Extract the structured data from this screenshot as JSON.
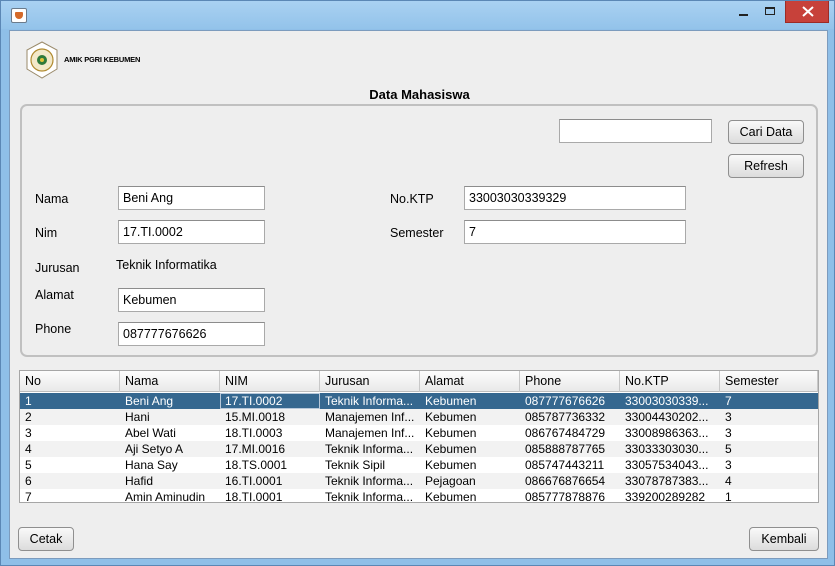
{
  "window": {
    "controls": {
      "minimize": "minimize-icon",
      "maximize": "maximize-icon",
      "close": "close-icon"
    }
  },
  "header": {
    "logo_text": "AMIK PGRI KEBUMEN",
    "title": "Data Mahasiswa"
  },
  "search": {
    "value": "",
    "button_label": "Cari Data",
    "refresh_label": "Refresh"
  },
  "form": {
    "nama_label": "Nama",
    "nama_value": "Beni Ang",
    "nim_label": "Nim",
    "nim_value": "17.TI.0002",
    "jurusan_label": "Jurusan",
    "jurusan_value": "Teknik Informatika",
    "alamat_label": "Alamat",
    "alamat_value": "Kebumen",
    "phone_label": "Phone",
    "phone_value": "087777676626",
    "ktp_label": "No.KTP",
    "ktp_value": "33003030339329",
    "semester_label": "Semester",
    "semester_value": "7"
  },
  "table": {
    "columns": [
      "No",
      "Nama",
      "NIM",
      "Jurusan",
      "Alamat",
      "Phone",
      "No.KTP",
      "Semester"
    ],
    "rows": [
      [
        "1",
        "Beni Ang",
        "17.TI.0002",
        "Teknik Informa...",
        "Kebumen",
        "087777676626",
        "33003030339...",
        "7"
      ],
      [
        "2",
        "Hani",
        "15.MI.0018",
        "Manajemen Inf...",
        "Kebumen",
        "085787736332",
        "33004430202...",
        "3"
      ],
      [
        "3",
        "Abel Wati",
        "18.TI.0003",
        "Manajemen Inf...",
        "Kebumen",
        "086767484729",
        "33008986363...",
        "3"
      ],
      [
        "4",
        "Aji Setyo A",
        "17.MI.0016",
        "Teknik Informa...",
        "Kebumen",
        "085888787765",
        "33033303030...",
        "5"
      ],
      [
        "5",
        "Hana Say",
        "18.TS.0001",
        "Teknik Sipil",
        "Kebumen",
        "085747443211",
        "33057534043...",
        "3"
      ],
      [
        "6",
        "Hafid",
        "16.TI.0001",
        "Teknik Informa...",
        "Pejagoan",
        "086676876654",
        "33078787383...",
        "4"
      ],
      [
        "7",
        "Amin Aminudin",
        "18.TI.0001",
        "Teknik Informa...",
        "Kebumen",
        "085777878876",
        "339200289282",
        "1"
      ]
    ],
    "selected_row": 0
  },
  "footer": {
    "print_label": "Cetak",
    "back_label": "Kembali"
  },
  "colors": {
    "titlebar": "#9ccaf0",
    "selection": "#35678f",
    "close": "#c7413a"
  }
}
